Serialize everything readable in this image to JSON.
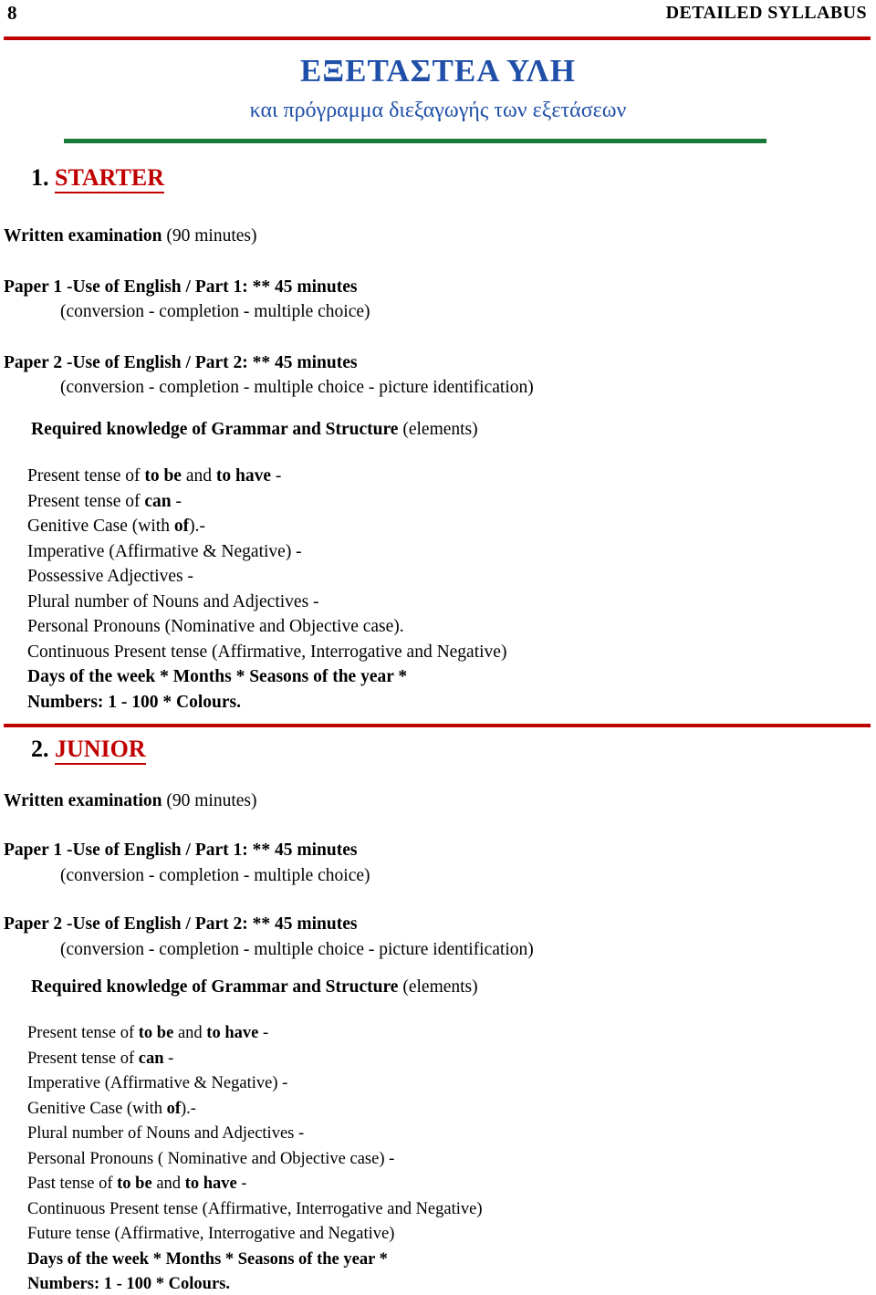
{
  "header": {
    "page_number": "8",
    "title": "DETAILED SYLLABUS"
  },
  "title_block": {
    "greek_title": "ΕΞΕΤΑΣΤΕΑ ΥΛΗ",
    "greek_subtitle": "και πρόγραμμα διεξαγωγής των εξετάσεων"
  },
  "sections": [
    {
      "number": "1.",
      "name": "STARTER",
      "exam_line_bold": "Written examination",
      "exam_line_rest": " (90 minutes)",
      "papers": [
        {
          "heading": "Paper 1 -Use of English / Part 1: ** 45 minutes",
          "detail": "(conversion - completion - multiple choice)"
        },
        {
          "heading": "Paper 2 -Use of English / Part 2: ** 45 minutes",
          "detail": "(conversion - completion - multiple choice - picture identification)"
        }
      ],
      "required_bold": "Required knowledge of Grammar and Structure",
      "required_rest": "  (elements)",
      "items": [
        {
          "parts": [
            {
              "t": "Present tense of ",
              "b": false
            },
            {
              "t": "to be",
              "b": true
            },
            {
              "t": " and ",
              "b": false
            },
            {
              "t": "to have",
              "b": true
            },
            {
              "t": " -",
              "b": false
            }
          ]
        },
        {
          "parts": [
            {
              "t": "Present tense of ",
              "b": false
            },
            {
              "t": "can",
              "b": true
            },
            {
              "t": " -",
              "b": false
            }
          ]
        },
        {
          "parts": [
            {
              "t": "Genitive Case (with ",
              "b": false
            },
            {
              "t": "of",
              "b": true
            },
            {
              "t": ").-",
              "b": false
            }
          ]
        },
        {
          "parts": [
            {
              "t": "Imperative (Affirmative & Negative) -",
              "b": false
            }
          ]
        },
        {
          "parts": [
            {
              "t": "Possessive Adjectives -",
              "b": false
            }
          ]
        },
        {
          "parts": [
            {
              "t": "Plural number of  Nouns and Adjectives -",
              "b": false
            }
          ]
        },
        {
          "parts": [
            {
              "t": "Personal Pronouns (Nominative and Objective case).",
              "b": false
            }
          ]
        },
        {
          "parts": [
            {
              "t": "Continuous Present tense (Affirmative, Interrogative and Negative)",
              "b": false
            }
          ]
        },
        {
          "parts": [
            {
              "t": "Days of the week  *  Months  *  Seasons of the year  *",
              "b": true
            }
          ]
        },
        {
          "parts": [
            {
              "t": "Numbers: 1 - 100  *  Colours.",
              "b": true
            }
          ]
        }
      ]
    },
    {
      "number": "2.",
      "name": "JUNIOR",
      "exam_line_bold": "Written examination",
      "exam_line_rest": " (90 minutes)",
      "papers": [
        {
          "heading": "Paper 1 -Use of English / Part 1: ** 45 minutes",
          "detail": "(conversion - completion - multiple choice)"
        },
        {
          "heading": "Paper 2 -Use of English / Part 2: ** 45 minutes",
          "detail": "(conversion - completion - multiple choice - picture identification)"
        }
      ],
      "required_bold": "Required knowledge of Grammar and Structure",
      "required_rest": "  (elements)",
      "items": [
        {
          "parts": [
            {
              "t": "Present tense of ",
              "b": false
            },
            {
              "t": "to be",
              "b": true
            },
            {
              "t": " and ",
              "b": false
            },
            {
              "t": "to have",
              "b": true
            },
            {
              "t": " -",
              "b": false
            }
          ]
        },
        {
          "parts": [
            {
              "t": "Present tense of ",
              "b": false
            },
            {
              "t": "can",
              "b": true
            },
            {
              "t": " -",
              "b": false
            }
          ]
        },
        {
          "parts": [
            {
              "t": "Imperative (Affirmative & Negative) -",
              "b": false
            }
          ]
        },
        {
          "parts": [
            {
              "t": "Genitive Case (with ",
              "b": false
            },
            {
              "t": "of",
              "b": true
            },
            {
              "t": ").-",
              "b": false
            }
          ]
        },
        {
          "parts": [
            {
              "t": "Plural number of Nouns and Adjectives -",
              "b": false
            }
          ]
        },
        {
          "parts": [
            {
              "t": "Personal Pronouns ( Nominative and Objective case) -",
              "b": false
            }
          ]
        },
        {
          "parts": [
            {
              "t": "Past tense of  ",
              "b": false
            },
            {
              "t": "to be",
              "b": true
            },
            {
              "t": " and ",
              "b": false
            },
            {
              "t": "to have",
              "b": true
            },
            {
              "t": " -",
              "b": false
            }
          ]
        },
        {
          "parts": [
            {
              "t": "Continuous Present tense (Affirmative, Interrogative and Negative)",
              "b": false
            }
          ]
        },
        {
          "parts": [
            {
              "t": "Future tense (Affirmative, Interrogative and Negative)",
              "b": false
            }
          ]
        },
        {
          "parts": [
            {
              "t": "Days of the week  *  Months  *  Seasons of the year  *",
              "b": true
            }
          ]
        },
        {
          "parts": [
            {
              "t": "Numbers: 1 - 100  *  Colours.",
              "b": true
            }
          ]
        }
      ]
    }
  ],
  "colors": {
    "red_rule": "#c00000",
    "green_rule": "#1b7a3a",
    "blue_title": "#1f4fa8"
  }
}
